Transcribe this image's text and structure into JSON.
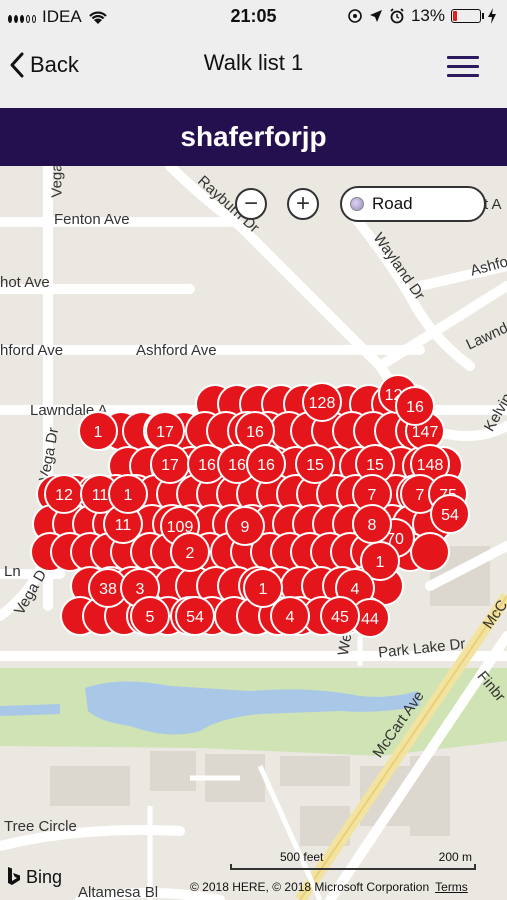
{
  "status_bar": {
    "carrier": "IDEA",
    "time": "21:05",
    "battery_percent": "13%",
    "battery_level": 0.13,
    "battery_color": "#e0201c",
    "icons": [
      "signal-icon",
      "wifi-icon",
      "location-icon",
      "alarm-icon",
      "charging-icon"
    ]
  },
  "nav": {
    "back_label": "Back",
    "title": "Walk list 1"
  },
  "banner": {
    "title": "shaferforjp",
    "background": "#24104f"
  },
  "map": {
    "zoom_out": "−",
    "zoom_in": "+",
    "layer": "Road",
    "streets": {
      "fenton": "Fenton Ave",
      "rayburn": "Rayburn Dr",
      "wayland": "Wayland Dr",
      "ashford_w": "hford Ave",
      "ashford": "Ashford Ave",
      "hot": "hot Ave",
      "ashfo_e": "Ashfo",
      "lawndale": "Lawndale A",
      "lawnd_e": "Lawnd",
      "vega_top": "Vega",
      "vega_mid": "Vega Dr",
      "vega_low": "Vega D",
      "kelvin": "Kelvin",
      "ln": "Ln",
      "park_lake": "Park Lake Dr",
      "mccart": "McCart Ave",
      "mccart_e": "McC",
      "finbr": "Finbr",
      "tree_circle": "Tree Circle",
      "altamesa": "Altamesa Bl",
      "we": "We",
      "it_a": "t A"
    },
    "pin_labels": {
      "p126": "126",
      "p128": "128",
      "p147": "147",
      "p148": "148",
      "p12": "12",
      "p17a": "17",
      "p17b": "17",
      "p16a": "16",
      "p16b": "16",
      "p16c": "16",
      "p16d": "16",
      "p15a": "15",
      "p15b": "15",
      "p109": "109",
      "p9": "9",
      "p7a": "7",
      "p7b": "7",
      "p75": "75",
      "p70": "70",
      "p54": "54",
      "p1": "1",
      "p38": "38",
      "p3": "3",
      "p2": "2",
      "p4": "4",
      "p44": "44",
      "p54b": "54",
      "p5": "5",
      "p1b": "1",
      "p1c": "1",
      "p11": "11",
      "p11b": "11",
      "p8": "8",
      "p45": "45",
      "p4b": "4",
      "p16e": "16",
      "p1d": "1"
    },
    "pin_color": "#e4151b",
    "attribution": {
      "brand": "Bing",
      "scale_feet": "500 feet",
      "scale_meters": "200 m",
      "copyright": "© 2018 HERE, © 2018 Microsoft Corporation",
      "terms": "Terms"
    }
  }
}
